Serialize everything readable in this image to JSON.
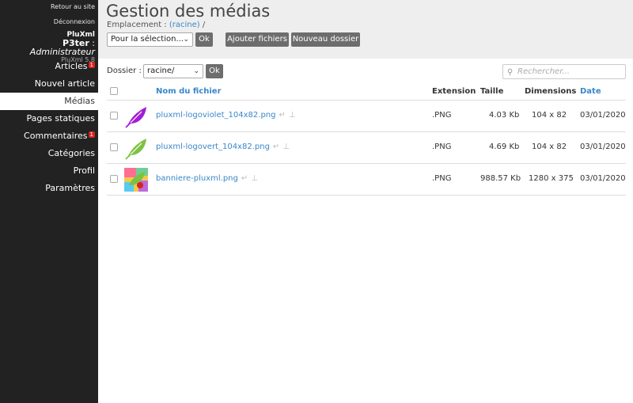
{
  "sidebar": {
    "back_to_site": "Retour au site",
    "logout": "Déconnexion",
    "brand": "PluXml",
    "user": "P3ter",
    "separator": " : ",
    "role": "Administrateur",
    "version": "PluXml 5.8",
    "items": [
      {
        "label": "Articles",
        "badge": "1",
        "active": false
      },
      {
        "label": "Nouvel article",
        "badge": "",
        "active": false
      },
      {
        "label": "Médias",
        "badge": "",
        "active": true
      },
      {
        "label": "Pages statiques",
        "badge": "",
        "active": false
      },
      {
        "label": "Commentaires",
        "badge": "1",
        "active": false
      },
      {
        "label": "Catégories",
        "badge": "",
        "active": false
      },
      {
        "label": "Profil",
        "badge": "",
        "active": false
      },
      {
        "label": "Paramètres",
        "badge": "",
        "active": false
      }
    ]
  },
  "header": {
    "title": "Gestion des médias",
    "location_label": "Emplacement : ",
    "location_link": "(racine)",
    "location_suffix": " /",
    "selection_select": "Pour la sélection...",
    "ok": "Ok",
    "add_files": "Ajouter fichiers",
    "new_folder": "Nouveau dossier"
  },
  "toolbar": {
    "folder_label": "Dossier :",
    "folder_value": "racine/",
    "ok": "Ok",
    "search_placeholder": "Rechercher..."
  },
  "table": {
    "columns": [
      "Nom du fichier",
      "Extension",
      "Taille",
      "Dimensions",
      "Date"
    ],
    "rows": [
      {
        "name": "pluxml-logoviolet_104x82.png",
        "ext": ".PNG",
        "size": "4.03 Kb",
        "dims": "104 x 82",
        "date": "03/01/2020",
        "thumb": "leaf-violet"
      },
      {
        "name": "pluxml-logovert_104x82.png",
        "ext": ".PNG",
        "size": "4.69 Kb",
        "dims": "104 x 82",
        "date": "03/01/2020",
        "thumb": "leaf-green"
      },
      {
        "name": "banniere-pluxml.png",
        "ext": ".PNG",
        "size": "988.57 Kb",
        "dims": "1280 x 375",
        "date": "03/01/2020",
        "thumb": "banner"
      }
    ]
  },
  "colors": {
    "sidebar_bg": "#222222",
    "header_bg": "#eeeeee",
    "link": "#3a87c9",
    "badge": "#d9231d",
    "button": "#6d6d6d",
    "leaf_violet": "#a11fd4",
    "leaf_green": "#7cc242"
  }
}
